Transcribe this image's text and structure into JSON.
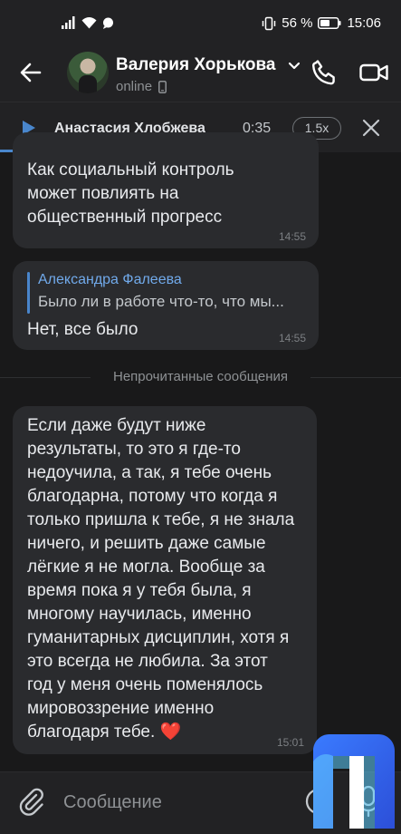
{
  "status_bar": {
    "battery": "56 %",
    "time": "15:06"
  },
  "header": {
    "contact_name": "Валерия Хорькова",
    "status": "online"
  },
  "player": {
    "title": "Анастасия Хлобжева",
    "time": "0:35",
    "speed": "1.5x",
    "progress": 0.42
  },
  "messages": [
    {
      "lines": [
        "Как социальный контроль",
        "может  повлиять на",
        "общественный прогресс"
      ],
      "time": "14:55"
    },
    {
      "reply_author": "Александра Фалеева",
      "reply_text": "Было ли в работе что-то, что мы...",
      "text": "Нет, все было",
      "time": "14:55"
    },
    {
      "lines": [
        "Если даже будут ниже",
        "результаты, то это я где-то",
        "недоучила, а так, я тебе очень",
        "благодарна, потому что когда я",
        "только пришла к тебе, я не знала",
        "ничего, и решить даже самые",
        "лёгкие я не могла. Вообще за",
        "время пока я у тебя была, я",
        "многому научилась, именно",
        "гуманитарных дисциплин, хотя я",
        "это всегда не любила. За этот",
        "год у меня очень поменялось",
        "мировоззрение именно",
        "благодаря тебе. ❤️"
      ],
      "time": "15:01"
    }
  ],
  "unread_divider": "Непрочитанные сообщения",
  "composer": {
    "placeholder": "Сообщение"
  },
  "colors": {
    "accent": "#4986cc",
    "background": "#19191a",
    "bubble": "#2a2b2e"
  }
}
